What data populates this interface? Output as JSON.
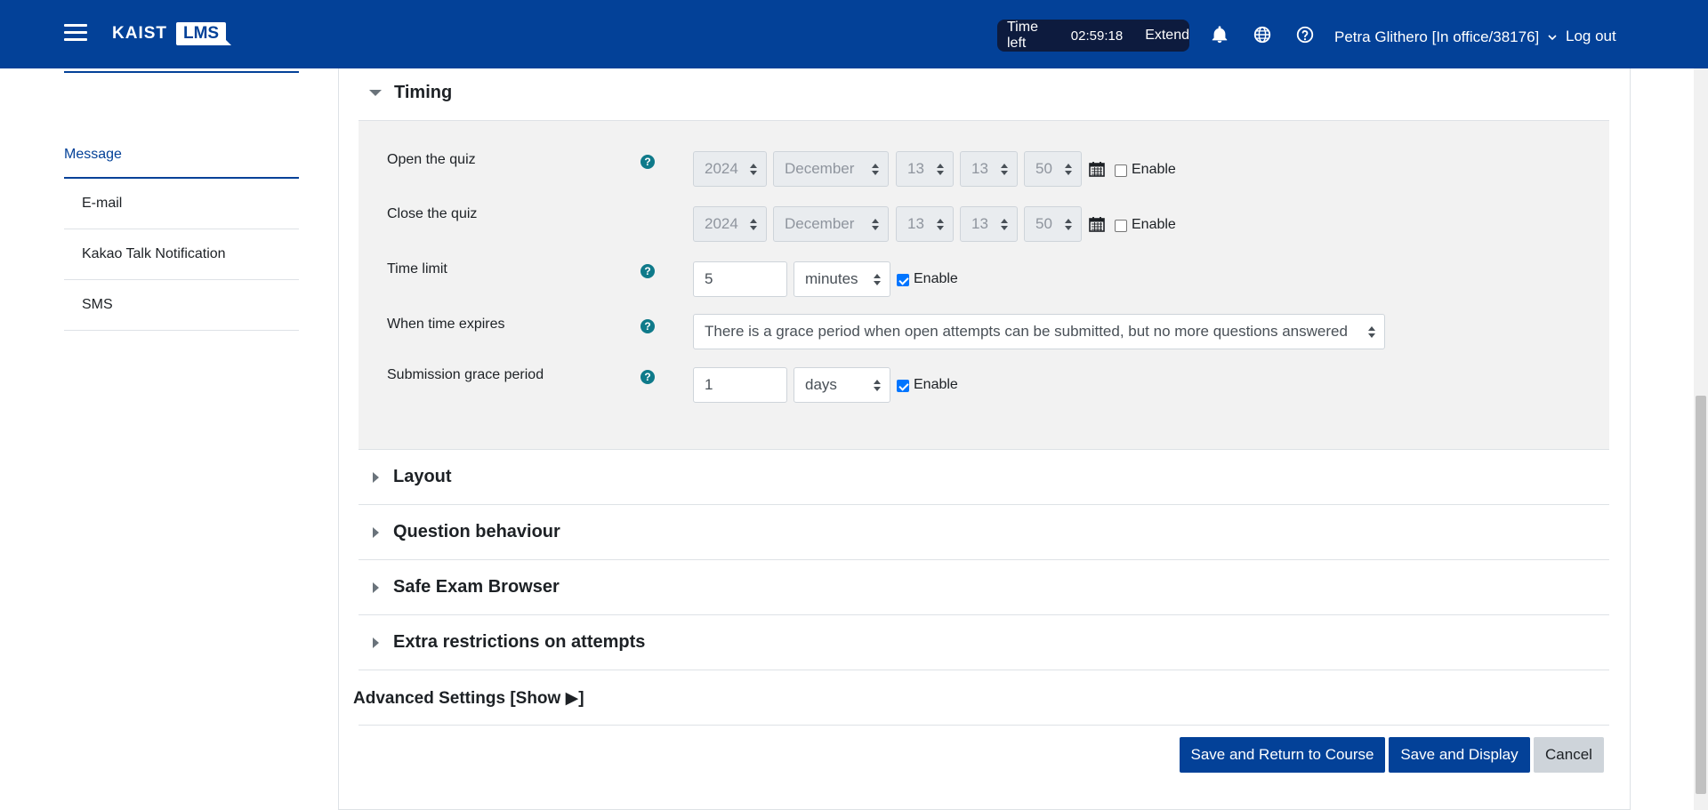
{
  "navbar": {
    "logo_word": "KAIST",
    "logo_box": "LMS",
    "timer_label": "Time left",
    "timer_value": "02:59:18",
    "timer_extend": "Extend",
    "user": "Petra Glithero [In office/38176]",
    "logout": "Log out"
  },
  "sidebar": {
    "heading": "Message",
    "items": [
      {
        "label": "E-mail"
      },
      {
        "label": "Kakao Talk Notification"
      },
      {
        "label": "SMS"
      }
    ]
  },
  "timing": {
    "title": "Timing",
    "open_label": "Open the quiz",
    "close_label": "Close the quiz",
    "time_limit_label": "Time limit",
    "when_expires_label": "When time expires",
    "grace_label": "Submission grace period",
    "open_date": {
      "year": "2024",
      "month": "December",
      "day": "13",
      "hour": "13",
      "minute": "50"
    },
    "close_date": {
      "year": "2024",
      "month": "December",
      "day": "13",
      "hour": "13",
      "minute": "50"
    },
    "enable_label": "Enable",
    "time_limit_value": "5",
    "time_limit_unit": "minutes",
    "when_expires_value": "There is a grace period when open attempts can be submitted, but no more questions answered",
    "grace_value": "1",
    "grace_unit": "days",
    "help_glyph": "?"
  },
  "sections": {
    "layout": "Layout",
    "question_behaviour": "Question behaviour",
    "safe_exam": "Safe Exam Browser",
    "extra_restrictions": "Extra restrictions on attempts"
  },
  "advanced": "Advanced Settings [Show ▶]",
  "buttons": {
    "save_return": "Save and Return to Course",
    "save_display": "Save and Display",
    "cancel": "Cancel"
  },
  "colors": {
    "navbar": "#034198",
    "timer_bg": "#0d1b3e",
    "primary": "#034198",
    "help": "#0f7a8a"
  }
}
